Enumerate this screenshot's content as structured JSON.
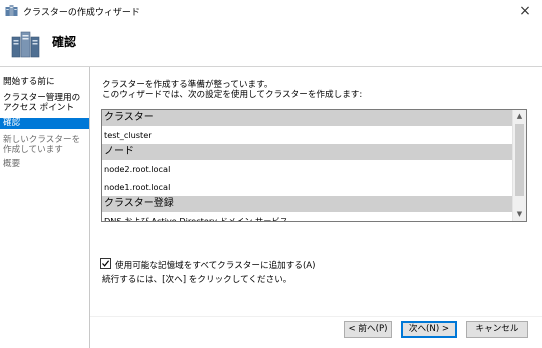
{
  "window": {
    "title": "クラスターの作成ウィザード",
    "close_glyph": "×"
  },
  "header": {
    "title": "確認"
  },
  "sidebar": {
    "items": [
      {
        "label": "開始する前に",
        "state": "normal"
      },
      {
        "label": "クラスター管理用のアクセス ポイント",
        "state": "normal"
      },
      {
        "label": "確認",
        "state": "active"
      },
      {
        "label": "新しいクラスターを作成しています",
        "state": "disabled"
      },
      {
        "label": "概要",
        "state": "disabled"
      }
    ]
  },
  "main": {
    "intro_line1": "クラスターを作成する準備が整っています。",
    "intro_line2": "このウィザードでは、次の設定を使用してクラスターを作成します:",
    "settings": [
      {
        "type": "header",
        "text": "クラスター"
      },
      {
        "type": "value",
        "text": "test_cluster"
      },
      {
        "type": "header",
        "text": "ノード"
      },
      {
        "type": "value",
        "text": "node2.root.local"
      },
      {
        "type": "value",
        "text": "node1.root.local"
      },
      {
        "type": "header",
        "text": "クラスター登録"
      },
      {
        "type": "value",
        "text": "DNS および Active Directory ドメイン サービス"
      }
    ],
    "scroll_up_glyph": "▲",
    "scroll_down_glyph": "▼",
    "checkbox_label": "使用可能な記憶域をすべてクラスターに追加する(A)",
    "checkbox_checked": true,
    "instruction": "続行するには、[次へ] をクリックしてください。"
  },
  "footer": {
    "prev_label": "< 前へ(P)",
    "next_label": "次へ(N) >",
    "cancel_label": "キャンセル"
  },
  "colors": {
    "accent": "#0078d7",
    "list_header_bg": "#cfcfcf"
  }
}
